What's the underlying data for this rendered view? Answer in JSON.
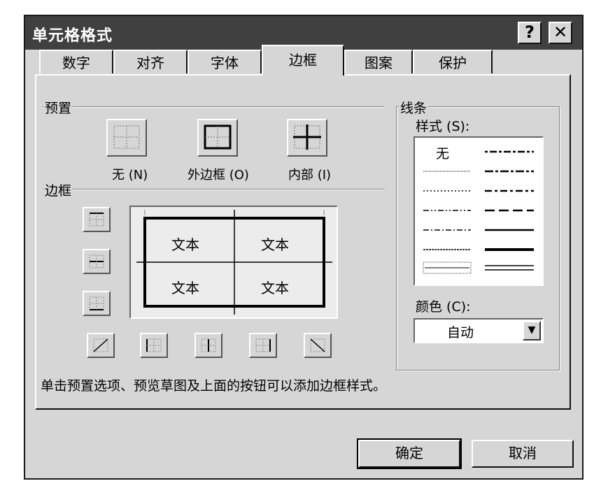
{
  "dialog": {
    "title": "单元格格式",
    "help_btn": "?",
    "close_btn": "✕"
  },
  "tabs": [
    {
      "label": "数字"
    },
    {
      "label": "对齐"
    },
    {
      "label": "字体"
    },
    {
      "label": "边框",
      "active": true
    },
    {
      "label": "图案"
    },
    {
      "label": "保护"
    }
  ],
  "presets": {
    "group_label": "预置",
    "none": "无 (N)",
    "outline": "外边框 (O)",
    "inside": "内部 (I)"
  },
  "border": {
    "group_label": "边框",
    "cells": [
      "文本",
      "文本",
      "文本",
      "文本"
    ]
  },
  "line": {
    "group_label": "线条",
    "style_label": "样式 (S):",
    "style_none": "无",
    "color_label": "颜色 (C):",
    "color_value": "自动"
  },
  "hint": "单击预置选项、预览草图及上面的按钮可以添加边框样式。",
  "buttons": {
    "ok": "确定",
    "cancel": "取消"
  }
}
